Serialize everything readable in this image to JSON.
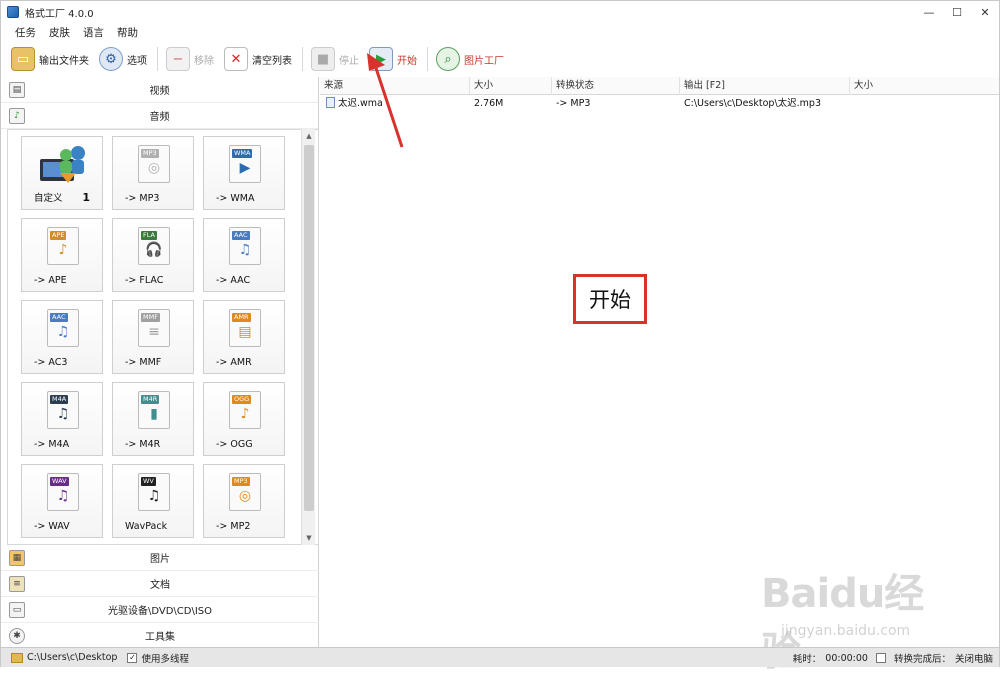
{
  "window": {
    "title": "格式工厂 4.0.0",
    "min": "—",
    "max": "☐",
    "close": "✕"
  },
  "menu": [
    "任务",
    "皮肤",
    "语言",
    "帮助"
  ],
  "toolbar": {
    "output_folder": "输出文件夹",
    "options": "选项",
    "remove": "移除",
    "clear_list": "清空列表",
    "stop": "停止",
    "start": "开始",
    "picture_factory": "图片工厂"
  },
  "categories_top": [
    {
      "label": "视频",
      "icon": "film-icon"
    },
    {
      "label": "音频",
      "icon": "music-note-icon"
    }
  ],
  "tiles": [
    {
      "label": "自定义",
      "tag": "",
      "badge": "1",
      "glyph": "",
      "color": "#2e7d32"
    },
    {
      "label": "-> MP3",
      "tag": "MP3",
      "badge": "",
      "glyph": "◎",
      "color": "#b0b0b0"
    },
    {
      "label": "-> WMA",
      "tag": "WMA",
      "badge": "",
      "glyph": "▶",
      "color": "#2b6cb0"
    },
    {
      "label": "-> APE",
      "tag": "APE",
      "badge": "",
      "glyph": "♪",
      "color": "#d58a2c"
    },
    {
      "label": "-> FLAC",
      "tag": "FLA",
      "badge": "",
      "glyph": "🎧",
      "color": "#3a7a3a"
    },
    {
      "label": "-> AAC",
      "tag": "AAC",
      "badge": "",
      "glyph": "♫",
      "color": "#4a7ac0"
    },
    {
      "label": "-> AC3",
      "tag": "AAC",
      "badge": "",
      "glyph": "♫",
      "color": "#4a7ac0"
    },
    {
      "label": "-> MMF",
      "tag": "MMF",
      "badge": "",
      "glyph": "≡",
      "color": "#a0a0a0"
    },
    {
      "label": "-> AMR",
      "tag": "AMR",
      "badge": "",
      "glyph": "▤",
      "color": "#e08a1e"
    },
    {
      "label": "-> M4A",
      "tag": "M4A",
      "badge": "",
      "glyph": "♫",
      "color": "#2c3e50"
    },
    {
      "label": "-> M4R",
      "tag": "M4R",
      "badge": "",
      "glyph": "▮",
      "color": "#3f8f8f"
    },
    {
      "label": "-> OGG",
      "tag": "OGG",
      "badge": "",
      "glyph": "♪",
      "color": "#e08a1e"
    },
    {
      "label": "-> WAV",
      "tag": "WAV",
      "badge": "",
      "glyph": "♫",
      "color": "#6a2c8a"
    },
    {
      "label": "WavPack",
      "tag": "WV",
      "badge": "",
      "glyph": "♫",
      "color": "#222222"
    },
    {
      "label": "-> MP2",
      "tag": "MP3",
      "badge": "",
      "glyph": "◎",
      "color": "#e08a1e"
    }
  ],
  "categories_bottom": [
    {
      "label": "图片",
      "icon": "picture-icon"
    },
    {
      "label": "文档",
      "icon": "document-icon"
    },
    {
      "label": "光驱设备\\DVD\\CD\\ISO",
      "icon": "disc-drive-icon"
    },
    {
      "label": "工具集",
      "icon": "tools-icon"
    }
  ],
  "list": {
    "columns": [
      "来源",
      "大小",
      "转换状态",
      "输出 [F2]",
      "大小"
    ],
    "rows": [
      {
        "source": "太迟.wma",
        "size": "2.76M",
        "status": "-> MP3",
        "output": "C:\\Users\\c\\Desktop\\太迟.mp3",
        "out_size": ""
      }
    ]
  },
  "annotation": {
    "text": "开始",
    "color": "#d8322d"
  },
  "status": {
    "path": "C:\\Users\\c\\Desktop",
    "multithread": "使用多线程",
    "elapsed_label": "耗时：",
    "elapsed": "00:00:00",
    "after_label": "转换完成后：",
    "after_value": "关闭电脑"
  },
  "watermark": {
    "main": "Baidu经验",
    "sub": "jingyan.baidu.com"
  }
}
